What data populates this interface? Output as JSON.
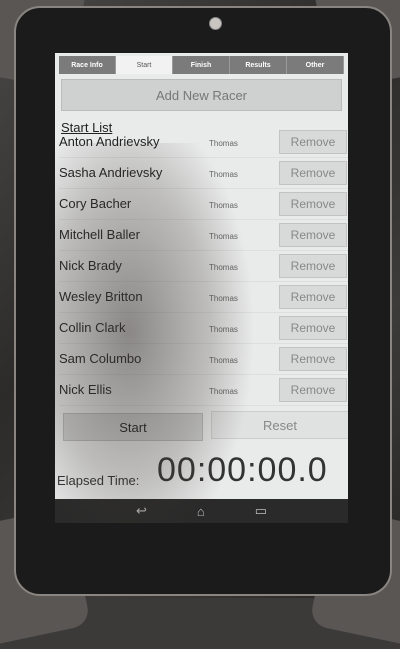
{
  "tabs": [
    {
      "label": "Race Info",
      "active": false
    },
    {
      "label": "Start",
      "active": true
    },
    {
      "label": "Finish",
      "active": false
    },
    {
      "label": "Results",
      "active": false
    },
    {
      "label": "Other",
      "active": false
    }
  ],
  "add_racer_label": "Add New Racer",
  "start_list_label": "Start List",
  "racers": [
    {
      "name": "Anton Andrievsky",
      "by": "Thomas",
      "remove_label": "Remove"
    },
    {
      "name": "Sasha Andrievsky",
      "by": "Thomas",
      "remove_label": "Remove"
    },
    {
      "name": "Cory Bacher",
      "by": "Thomas",
      "remove_label": "Remove"
    },
    {
      "name": "Mitchell Baller",
      "by": "Thomas",
      "remove_label": "Remove"
    },
    {
      "name": "Nick Brady",
      "by": "Thomas",
      "remove_label": "Remove"
    },
    {
      "name": "Wesley Britton",
      "by": "Thomas",
      "remove_label": "Remove"
    },
    {
      "name": "Collin Clark",
      "by": "Thomas",
      "remove_label": "Remove"
    },
    {
      "name": "Sam Columbo",
      "by": "Thomas",
      "remove_label": "Remove"
    },
    {
      "name": "Nick Ellis",
      "by": "Thomas",
      "remove_label": "Remove"
    }
  ],
  "start_label": "Start",
  "reset_label": "Reset",
  "elapsed_label": "Elapsed Time:",
  "elapsed_value": "00:00:00.0",
  "nav_icons": [
    "back-icon",
    "home-icon",
    "recent-apps-icon"
  ]
}
